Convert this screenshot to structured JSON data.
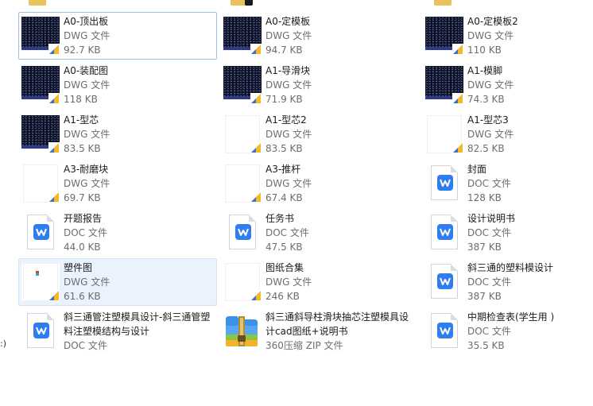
{
  "file_list": {
    "partial_label_left": ":)",
    "items": [
      {
        "name": "A0-顶出板",
        "type": "DWG 文件",
        "size": "92.7 KB",
        "icon": "dwg-dark"
      },
      {
        "name": "A0-定模板",
        "type": "DWG 文件",
        "size": "94.7 KB",
        "icon": "dwg-dark"
      },
      {
        "name": "A0-定模板2",
        "type": "DWG 文件",
        "size": "110 KB",
        "icon": "dwg-dark"
      },
      {
        "name": "A0-装配图",
        "type": "DWG 文件",
        "size": "118 KB",
        "icon": "dwg-dark"
      },
      {
        "name": "A1-导滑块",
        "type": "DWG 文件",
        "size": "71.9 KB",
        "icon": "dwg-dark"
      },
      {
        "name": "A1-模脚",
        "type": "DWG 文件",
        "size": "74.3 KB",
        "icon": "dwg-dark"
      },
      {
        "name": "A1-型芯",
        "type": "DWG 文件",
        "size": "83.5 KB",
        "icon": "dwg-dark"
      },
      {
        "name": "A1-型芯2",
        "type": "DWG 文件",
        "size": "83.5 KB",
        "icon": "dwg-white"
      },
      {
        "name": "A1-型芯3",
        "type": "DWG 文件",
        "size": "82.5 KB",
        "icon": "dwg-white"
      },
      {
        "name": "A3-耐磨块",
        "type": "DWG 文件",
        "size": "69.7 KB",
        "icon": "dwg-white"
      },
      {
        "name": "A3-推杆",
        "type": "DWG 文件",
        "size": "67.4 KB",
        "icon": "dwg-white"
      },
      {
        "name": "封面",
        "type": "DOC 文件",
        "size": "128 KB",
        "icon": "doc-wps"
      },
      {
        "name": "开题报告",
        "type": "DOC 文件",
        "size": "44.0 KB",
        "icon": "doc-wps"
      },
      {
        "name": "任务书",
        "type": "DOC 文件",
        "size": "47.5 KB",
        "icon": "doc-wps"
      },
      {
        "name": "设计说明书",
        "type": "DOC 文件",
        "size": "387 KB",
        "icon": "doc-wps"
      },
      {
        "name": "塑件图",
        "type": "DWG 文件",
        "size": "61.6 KB",
        "icon": "dwg-white-mini"
      },
      {
        "name": "图纸合集",
        "type": "DWG 文件",
        "size": "246 KB",
        "icon": "dwg-white"
      },
      {
        "name": "斜三通的塑料模设计",
        "type": "DOC 文件",
        "size": "387 KB",
        "icon": "doc-wps"
      },
      {
        "name": "斜三通管注塑模具设计-斜三通管塑料注塑模结构与设计",
        "type": "DOC 文件",
        "size": "",
        "icon": "doc-wps"
      },
      {
        "name": "斜三通斜导柱滑块抽芯注塑模具设计cad图纸+说明书",
        "type": "360压缩 ZIP 文件",
        "size": "",
        "icon": "zip-360"
      },
      {
        "name": "中期检查表(学生用 )",
        "type": "DOC 文件",
        "size": "35.5 KB",
        "icon": "doc-wps"
      }
    ]
  },
  "colors": {
    "selection_border": "#99c3e8",
    "hover_background": "#eaf3fd",
    "secondary_text": "#6d6d6d",
    "wps_blue": "#2f7ef0",
    "dwg_dark_bg": "#0a0f24"
  }
}
